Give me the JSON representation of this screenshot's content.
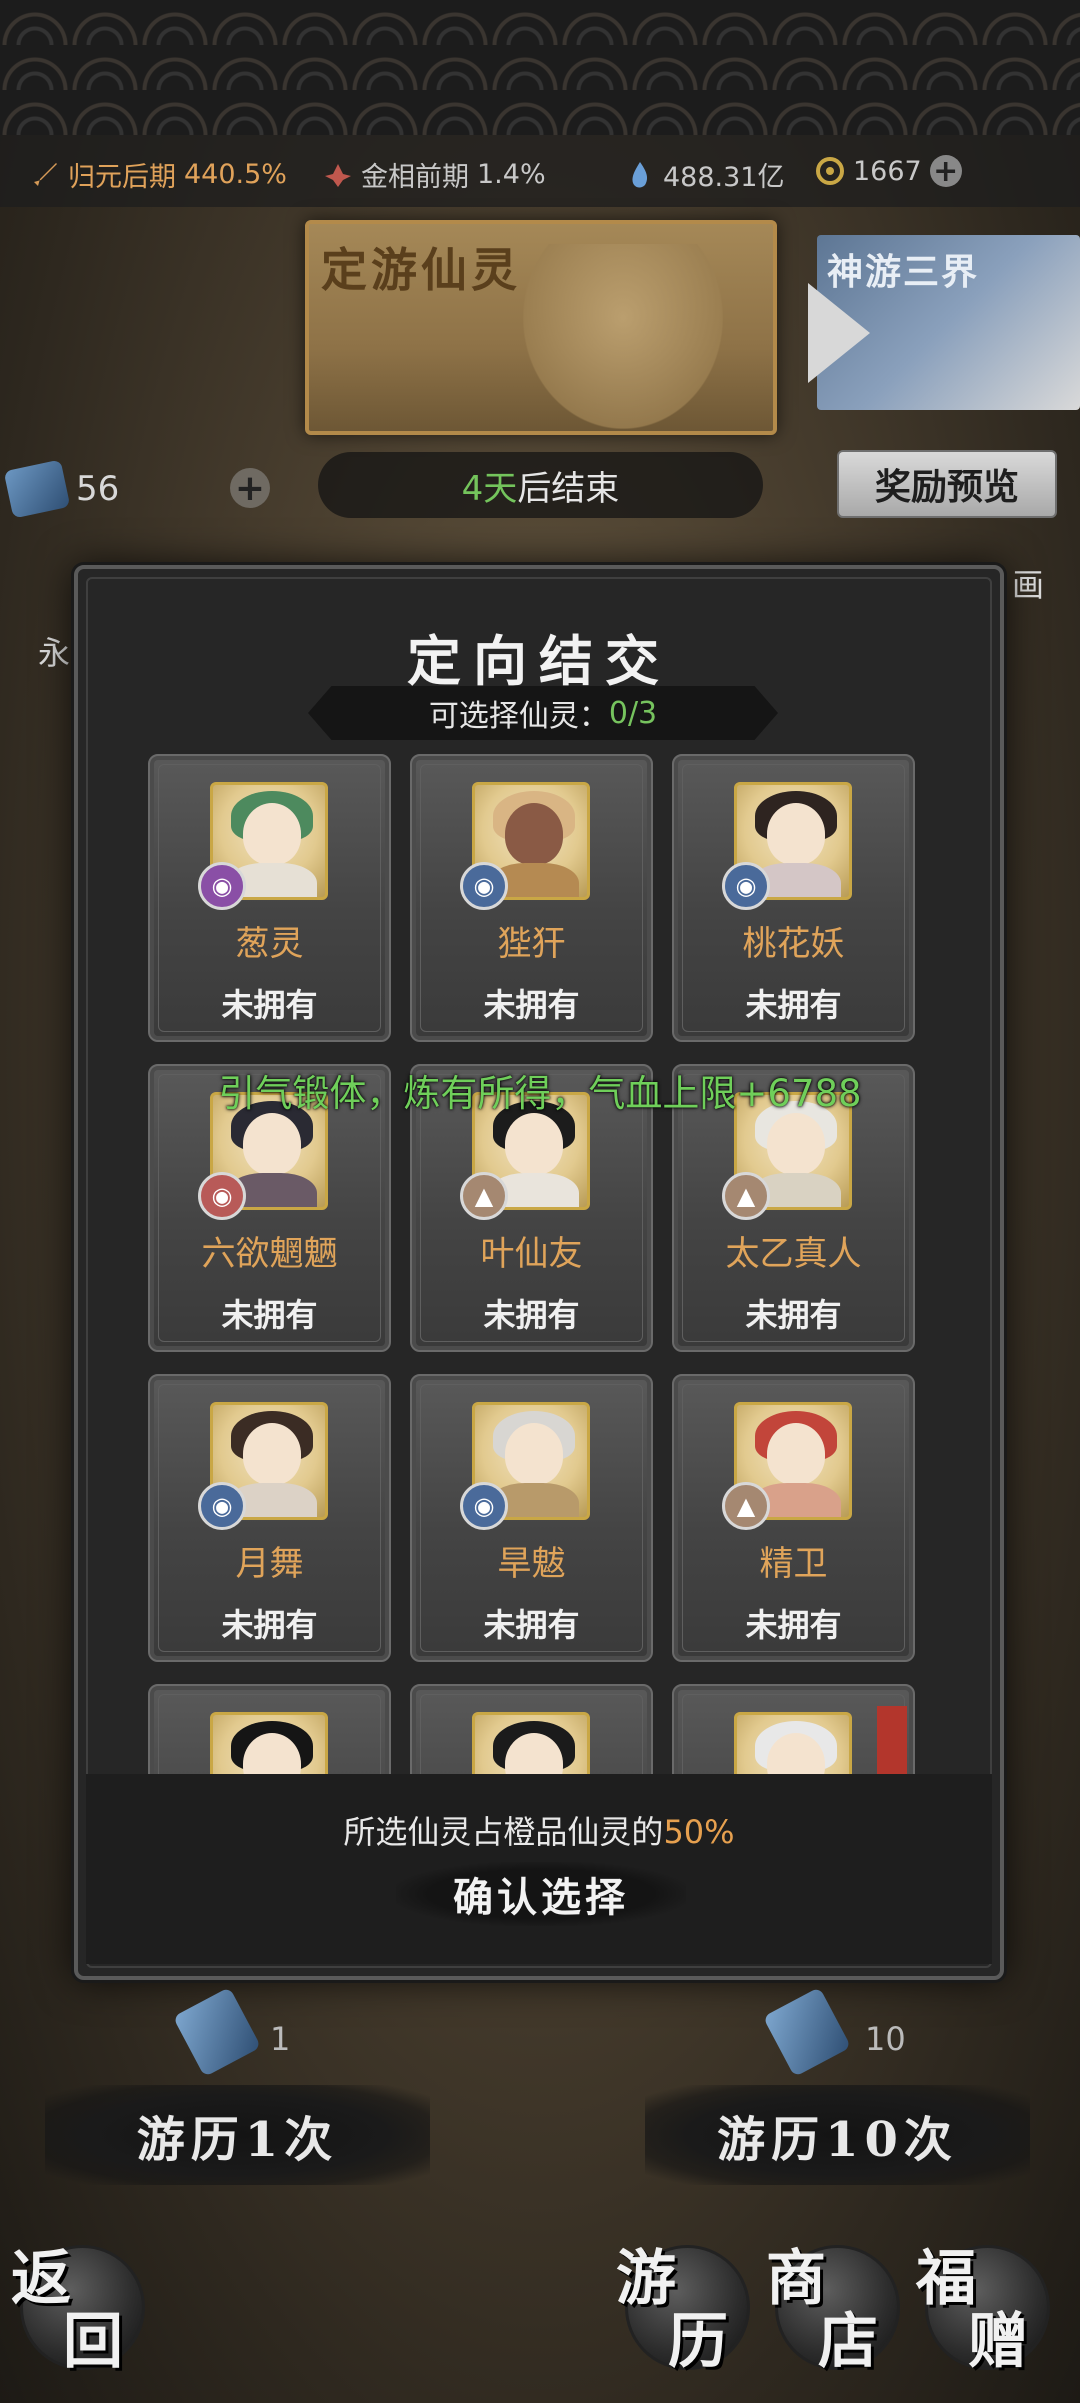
{
  "topbar": {
    "realm_label": "归元后期",
    "realm_value": "440.5%",
    "phase_label": "金相前期",
    "phase_value": "1.4%",
    "spirit_stones": "488.31亿",
    "jade": "1667"
  },
  "banner": {
    "main_title": "定游仙灵",
    "side_title": "神游三界"
  },
  "scroll_count": "56",
  "event_end": {
    "days": "4天",
    "suffix": "后结束"
  },
  "reward_preview_label": "奖励预览",
  "side_chars": {
    "left": "永",
    "right": "画"
  },
  "modal": {
    "title": "定向结交",
    "selectable_label": "可选择仙灵：",
    "selectable_value": "0/3",
    "cards": [
      {
        "name": "葱灵",
        "status": "未拥有",
        "element": "purple"
      },
      {
        "name": "狴犴",
        "status": "未拥有",
        "element": "blue"
      },
      {
        "name": "桃花妖",
        "status": "未拥有",
        "element": "blue"
      },
      {
        "name": "六欲魍魉",
        "status": "未拥有",
        "element": "red"
      },
      {
        "name": "叶仙友",
        "status": "未拥有",
        "element": "tan"
      },
      {
        "name": "太乙真人",
        "status": "未拥有",
        "element": "tan"
      },
      {
        "name": "月舞",
        "status": "未拥有",
        "element": "blue"
      },
      {
        "name": "旱魃",
        "status": "未拥有",
        "element": "blue"
      },
      {
        "name": "精卫",
        "status": "未拥有",
        "element": "tan"
      },
      {
        "name": "",
        "status": "",
        "element": ""
      },
      {
        "name": "",
        "status": "",
        "element": ""
      },
      {
        "name": "",
        "status": "",
        "element": ""
      }
    ],
    "footer_text": "所选仙灵占橙品仙灵的",
    "footer_percent": "50%",
    "confirm_label": "确认选择"
  },
  "toast": "引气锻体，炼有所得，气血上限+6788",
  "rolls": {
    "single": {
      "cost": "1",
      "label": "游历1次"
    },
    "ten": {
      "cost": "10",
      "label": "游历10次"
    }
  },
  "nav": {
    "back": [
      "返",
      "回"
    ],
    "travel": [
      "游",
      "历"
    ],
    "shop": [
      "商",
      "店"
    ],
    "gift": [
      "福",
      "赠"
    ]
  },
  "colors": {
    "accent_orange": "#e0a45a",
    "accent_green": "#74c45c",
    "gold_frame": "#c9a745"
  }
}
